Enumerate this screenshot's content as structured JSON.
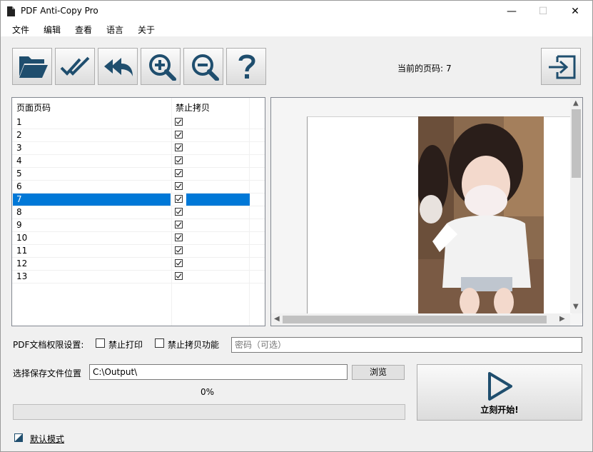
{
  "window": {
    "title": "PDF Anti-Copy Pro",
    "minimize": "—",
    "maximize": "☐",
    "close": "✕"
  },
  "menu": [
    "文件",
    "编辑",
    "查看",
    "语言",
    "关于"
  ],
  "toolbar": {
    "buttons": [
      {
        "icon": "folder-open-icon"
      },
      {
        "icon": "check-all-icon"
      },
      {
        "icon": "undo-all-icon"
      },
      {
        "icon": "zoom-in-icon"
      },
      {
        "icon": "zoom-out-icon"
      },
      {
        "icon": "help-icon"
      }
    ],
    "exit_icon": "exit-icon"
  },
  "page_info": {
    "label": "当前的页码:",
    "value": "7"
  },
  "table": {
    "headers": [
      "页面页码",
      "禁止拷贝"
    ],
    "rows": [
      {
        "page": "1",
        "checked": true
      },
      {
        "page": "2",
        "checked": true
      },
      {
        "page": "3",
        "checked": true
      },
      {
        "page": "4",
        "checked": true
      },
      {
        "page": "5",
        "checked": true
      },
      {
        "page": "6",
        "checked": true
      },
      {
        "page": "7",
        "checked": true,
        "selected": true
      },
      {
        "page": "8",
        "checked": true
      },
      {
        "page": "9",
        "checked": true
      },
      {
        "page": "10",
        "checked": true
      },
      {
        "page": "11",
        "checked": true
      },
      {
        "page": "12",
        "checked": true
      },
      {
        "page": "13",
        "checked": true
      }
    ]
  },
  "permissions": {
    "label": "PDF文档权限设置:",
    "no_print": "禁止打印",
    "no_copy": "禁止拷贝功能",
    "password_placeholder": "密码（可选）"
  },
  "save": {
    "label": "选择保存文件位置",
    "path": "C:\\Output\\",
    "browse": "浏览"
  },
  "progress": {
    "text": "0%",
    "value": 0
  },
  "start": {
    "label": "立刻开始!"
  },
  "mode": {
    "label": "默认模式"
  },
  "colors": {
    "selection": "#0078d7",
    "icon_blue": "#1f4e6e",
    "accent_green": "#06b025"
  }
}
